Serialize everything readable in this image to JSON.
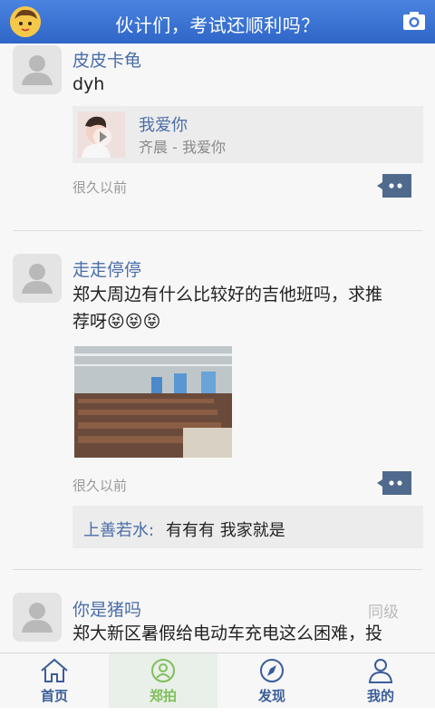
{
  "header": {
    "title": "伙计们，考试还顺利吗？",
    "left_icon": "user-avatar-icon",
    "right_icon": "camera-icon"
  },
  "posts": [
    {
      "author": "皮皮卡龟",
      "text": "dyh",
      "music": {
        "song": "我爱你",
        "artist": "齐晨 - 我爱你"
      },
      "time": "很久以前"
    },
    {
      "author": "走走停停",
      "text_line1": "郑大周边有什么比较好的吉他班吗，求推",
      "text_line2": "荐呀😝😝😝",
      "time": "很久以前",
      "reply": {
        "name": "上善若水:",
        "text": "有有有 我家就是"
      }
    },
    {
      "author": "你是猪吗",
      "badge": "同级",
      "text": "郑大新区暑假给电动车充电这么困难，投"
    }
  ],
  "nav": {
    "tabs": [
      {
        "label": "首页",
        "icon": "home-icon"
      },
      {
        "label": "郑拍",
        "icon": "zhengpai-icon",
        "active": true
      },
      {
        "label": "发现",
        "icon": "compass-icon"
      },
      {
        "label": "我的",
        "icon": "profile-icon"
      }
    ]
  },
  "colors": {
    "header": "#3a74d8",
    "link": "#4a6ea8",
    "active_tab": "#7fbf5a"
  }
}
